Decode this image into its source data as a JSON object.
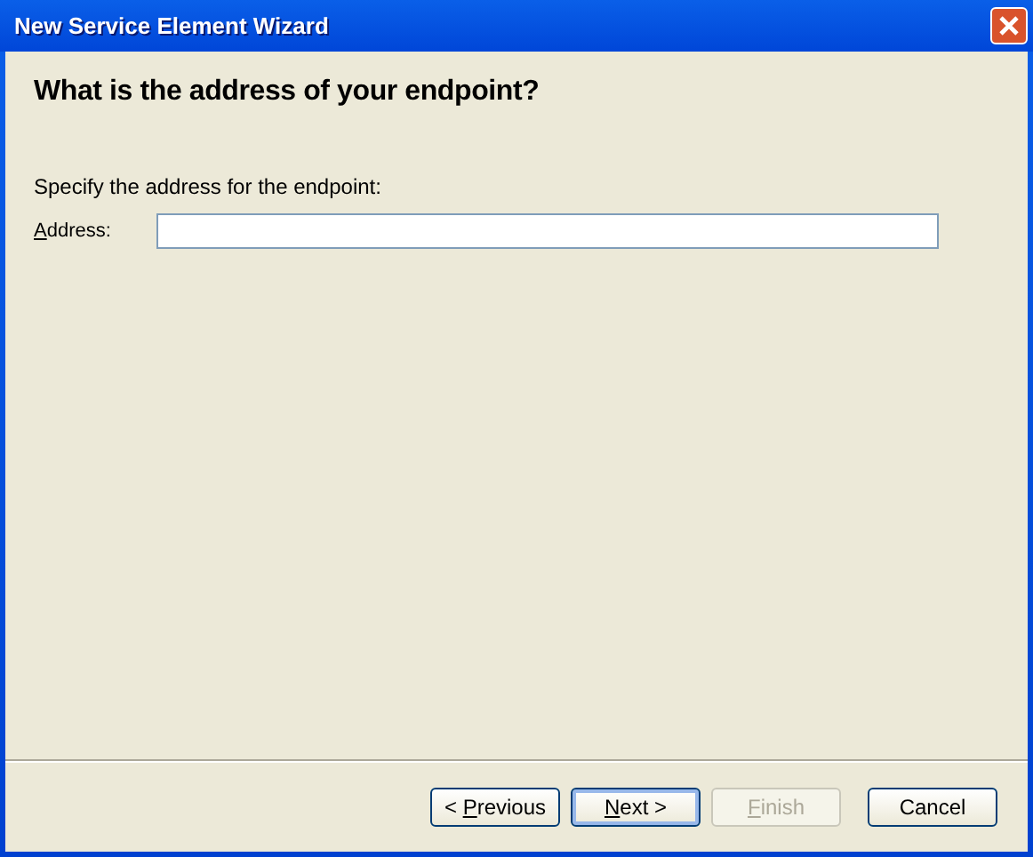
{
  "window": {
    "title": "New Service Element Wizard"
  },
  "heading": "What is the address of your endpoint?",
  "instruction": "Specify the address for the endpoint:",
  "address_field": {
    "label": {
      "key": "A",
      "after": "ddress:"
    }
  },
  "buttons": [
    {
      "label": {
        "before": "< ",
        "key": "P",
        "after": "revious"
      },
      "default": false,
      "disabled": false
    },
    {
      "label": {
        "key": "N",
        "after": "ext >"
      },
      "default": true,
      "disabled": false
    },
    {
      "label": {
        "key": "F",
        "after": "inish"
      },
      "default": false,
      "disabled": true
    },
    {
      "label": {
        "before": "Cancel"
      },
      "default": false,
      "disabled": false
    }
  ]
}
